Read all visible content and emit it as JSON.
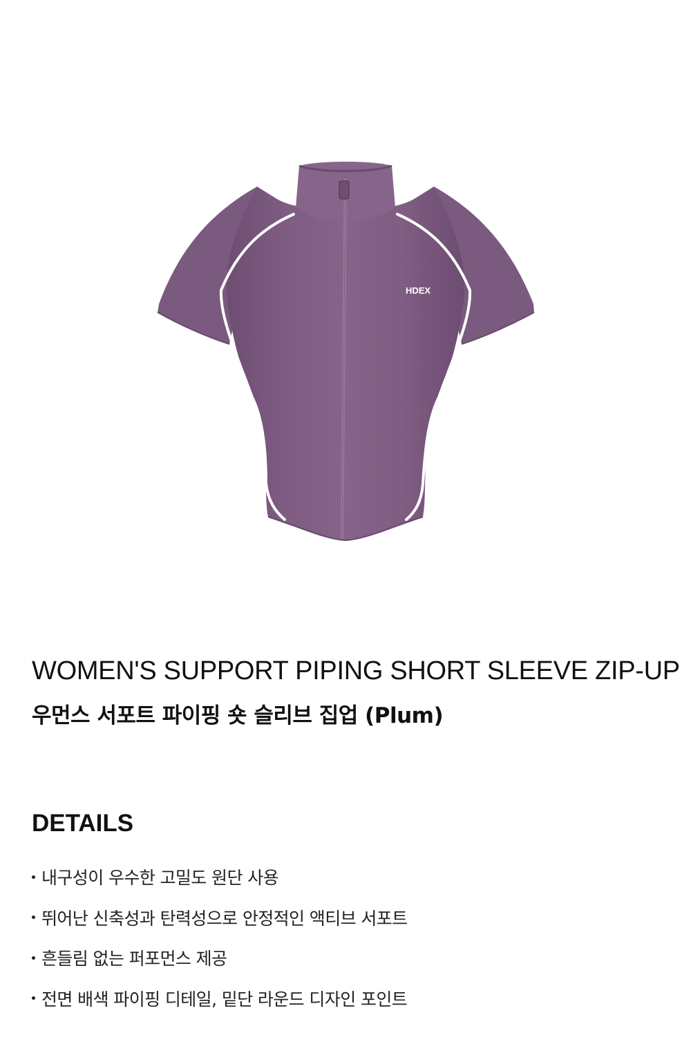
{
  "product": {
    "name_en": "WOMEN'S SUPPORT PIPING SHORT SLEEVE ZIP-UP",
    "name_ko": "우먼스 서포트 파이핑 숏 슬리브 집업 (Plum)",
    "logo_text": "HDEX",
    "garment_color": "#7d5b80",
    "piping_color": "#ffffff"
  },
  "details": {
    "heading": "DETAILS",
    "items": [
      "내구성이 우수한 고밀도 원단 사용",
      "뛰어난 신축성과 탄력성으로 안정적인 액티브 서포트",
      "흔들림 없는 퍼포먼스 제공",
      "전면 배색 파이핑 디테일, 밑단 라운드 디자인 포인트"
    ]
  }
}
